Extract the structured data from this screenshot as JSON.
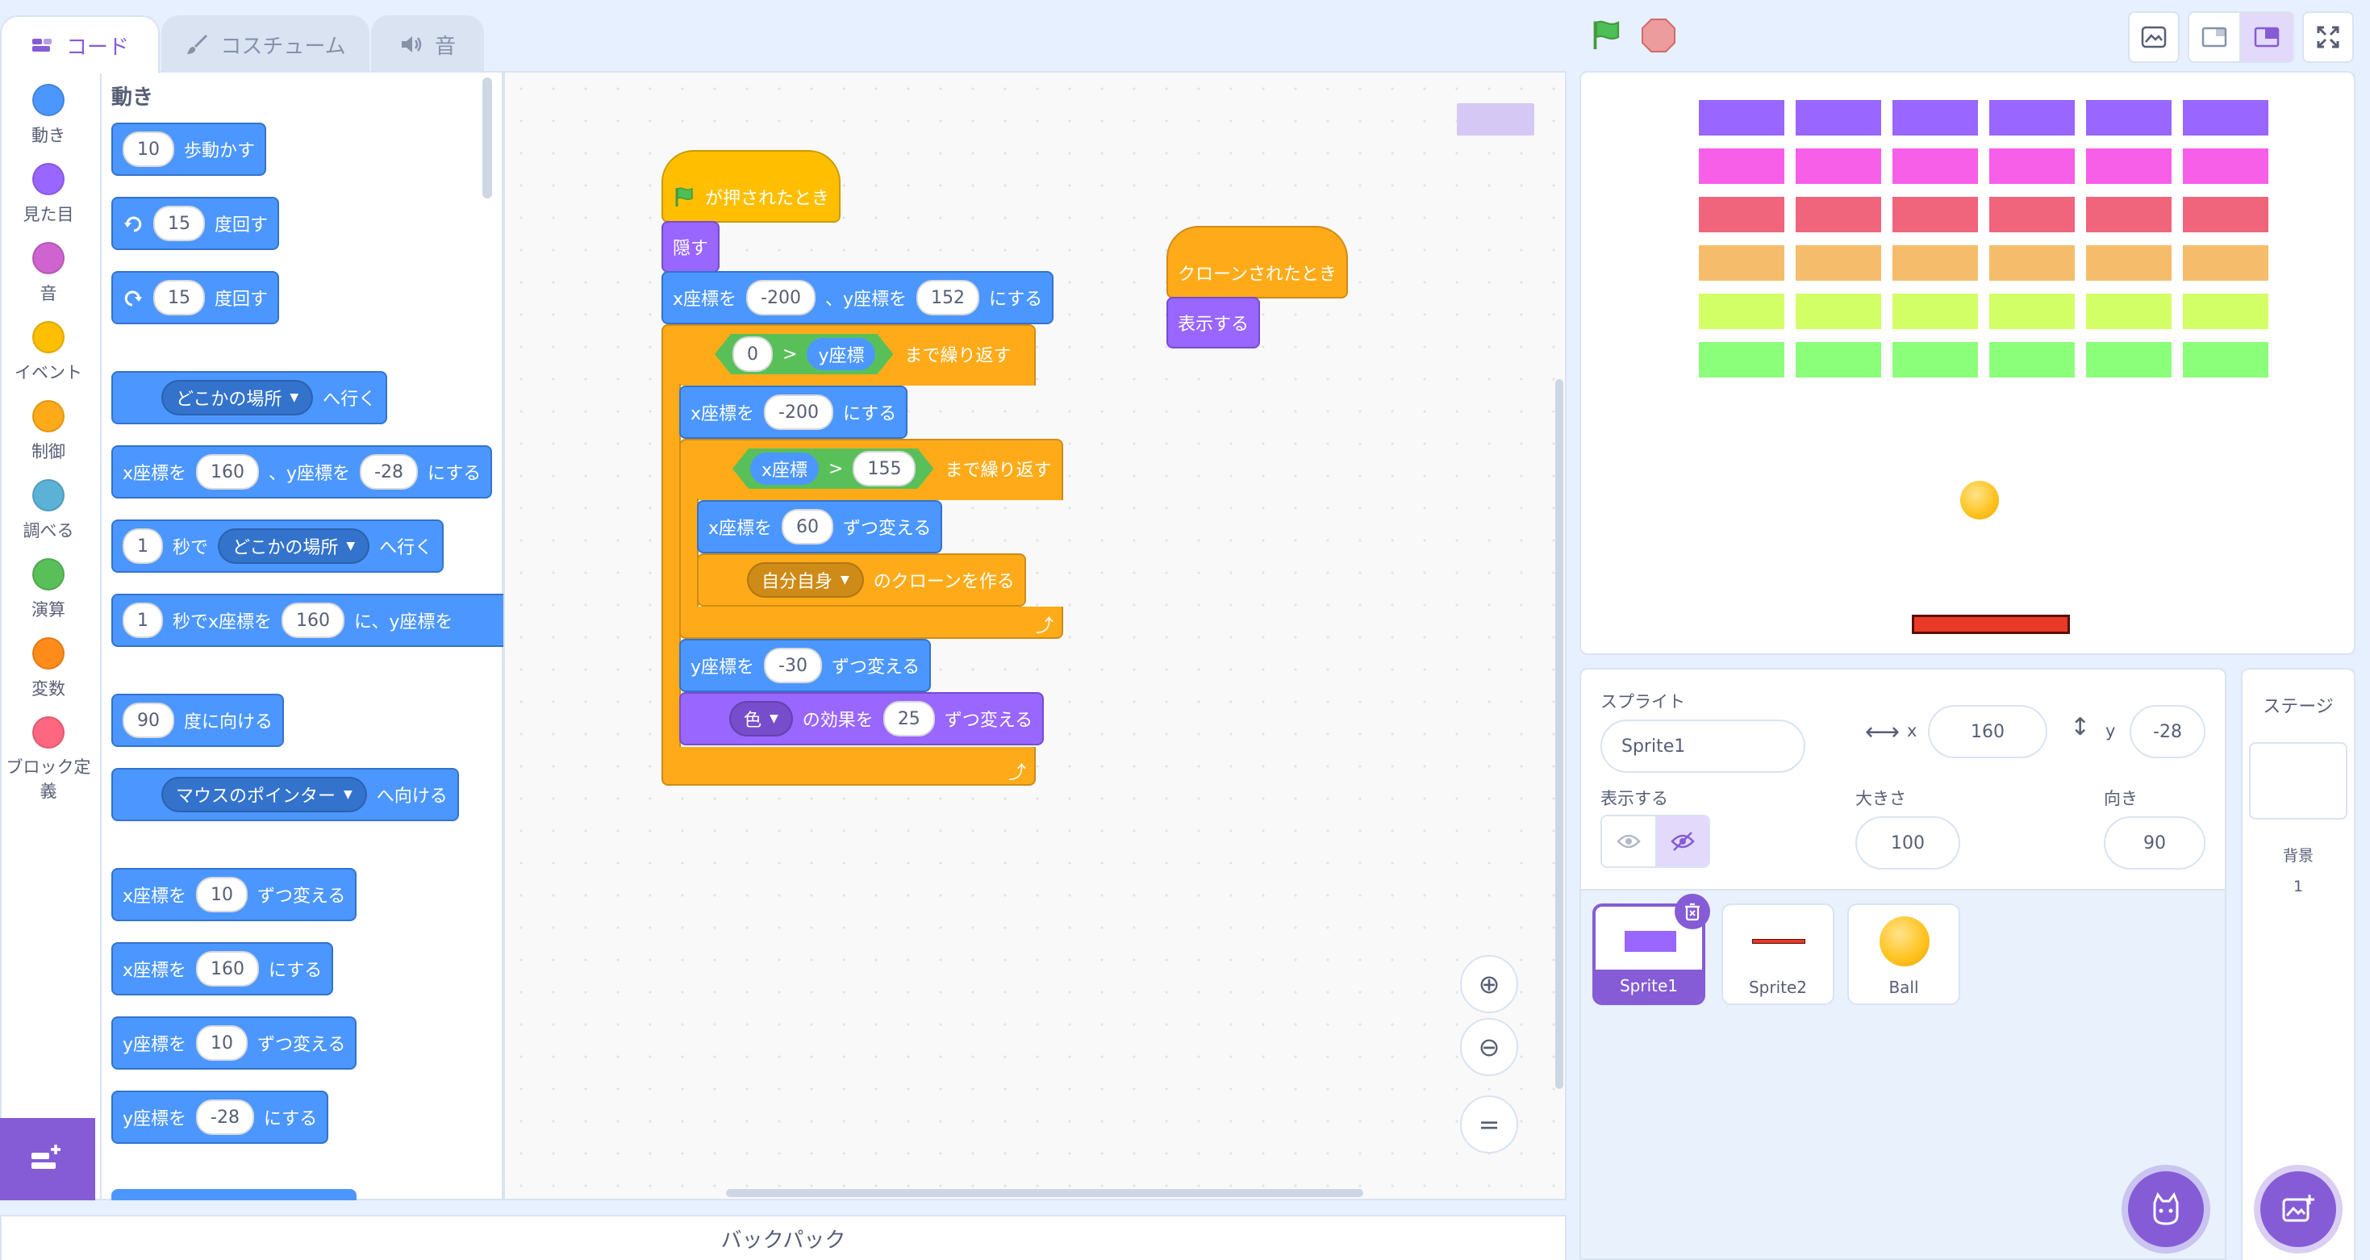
{
  "tabs": [
    {
      "label": "コード",
      "icon": "code-icon"
    },
    {
      "label": "コスチューム",
      "icon": "brush-icon"
    },
    {
      "label": "音",
      "icon": "speaker-icon"
    }
  ],
  "categories": [
    {
      "label": "動き",
      "color": "#4c97ff"
    },
    {
      "label": "見た目",
      "color": "#9966ff"
    },
    {
      "label": "音",
      "color": "#cf63cf"
    },
    {
      "label": "イベント",
      "color": "#ffbf00"
    },
    {
      "label": "制御",
      "color": "#ffab19"
    },
    {
      "label": "調べる",
      "color": "#5cb1d6"
    },
    {
      "label": "演算",
      "color": "#59c059"
    },
    {
      "label": "変数",
      "color": "#ff8c1a"
    },
    {
      "label": "ブロック定義",
      "color": "#ff6680"
    }
  ],
  "palette": {
    "heading": "動き",
    "move": {
      "value": "10",
      "text": "歩動かす"
    },
    "turn_right": {
      "value": "15",
      "text": "度回す"
    },
    "turn_left": {
      "value": "15",
      "text": "度回す"
    },
    "goto": {
      "dropdown": "どこかの場所",
      "text": "へ行く"
    },
    "goto_xy": {
      "x_label": "x座標を",
      "x": "160",
      "sep": "、y座標を",
      "y": "-28",
      "end": "にする"
    },
    "glide": {
      "value": "1",
      "mid": "秒で",
      "dropdown": "どこかの場所",
      "end": "へ行く"
    },
    "glide_xy": {
      "value": "1",
      "mid": "秒でx座標を",
      "x": "160",
      "sep": "に、y座標を"
    },
    "point_dir": {
      "value": "90",
      "text": "度に向ける"
    },
    "point_towards": {
      "dropdown": "マウスのポインター",
      "text": "へ向ける"
    },
    "change_x": {
      "label": "x座標を",
      "value": "10",
      "text": "ずつ変える"
    },
    "set_x": {
      "label": "x座標を",
      "value": "160",
      "text": "にする"
    },
    "change_y": {
      "label": "y座標を",
      "value": "10",
      "text": "ずつ変える"
    },
    "set_y": {
      "label": "y座標を",
      "value": "-28",
      "text": "にする"
    }
  },
  "script1": {
    "hat": "が押されたとき",
    "hide": "隠す",
    "goto_xy": {
      "x_label": "x座標を",
      "x": "-200",
      "sep": "、y座標を",
      "y": "152",
      "end": "にする"
    },
    "repeat_until_outer": {
      "left": "0",
      "op": ">",
      "reporter": "y座標",
      "text": "まで繰り返す"
    },
    "set_x": {
      "label": "x座標を",
      "value": "-200",
      "text": "にする"
    },
    "repeat_until_inner": {
      "reporter": "x座標",
      "op": ">",
      "right": "155",
      "text": "まで繰り返す"
    },
    "change_x": {
      "label": "x座標を",
      "value": "60",
      "text": "ずつ変える"
    },
    "create_clone": {
      "dropdown": "自分自身",
      "text": "のクローンを作る"
    },
    "change_y": {
      "label": "y座標を",
      "value": "-30",
      "text": "ずつ変える"
    },
    "change_effect": {
      "dropdown": "色",
      "mid": "の効果を",
      "value": "25",
      "text": "ずつ変える"
    }
  },
  "script2": {
    "hat": "クローンされたとき",
    "show": "表示する"
  },
  "backpack": "バックパック",
  "stage_bricks": {
    "rows": [
      "#9966ff",
      "#f75fe8",
      "#f0647c",
      "#f5bd6b",
      "#d3ff66",
      "#8cff7a"
    ],
    "columns": 6
  },
  "sprite_info": {
    "sprite_label": "スプライト",
    "sprite_name": "Sprite1",
    "x_label": "x",
    "x": "160",
    "y_label": "y",
    "y": "-28",
    "show_label": "表示する",
    "size_label": "大きさ",
    "size": "100",
    "direction_label": "向き",
    "direction": "90"
  },
  "sprites": [
    {
      "name": "Sprite1",
      "selected": true
    },
    {
      "name": "Sprite2",
      "selected": false
    },
    {
      "name": "Ball",
      "selected": false
    }
  ],
  "stage_panel": {
    "title": "ステージ",
    "backdrop_label": "背景",
    "backdrop_count": "1"
  }
}
